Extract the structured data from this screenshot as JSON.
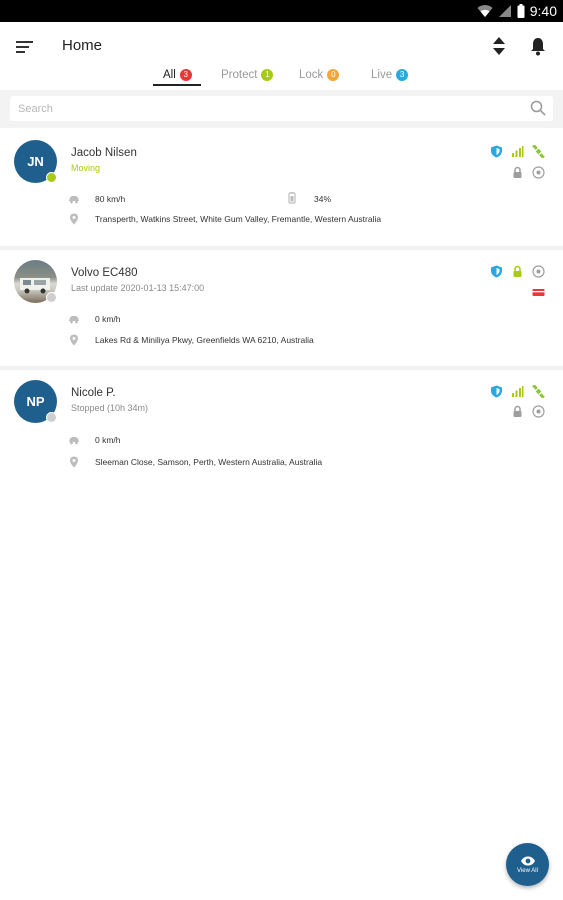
{
  "status_bar": {
    "time": "9:40"
  },
  "header": {
    "title": "Home"
  },
  "tabs": [
    {
      "label": "All",
      "count": "3",
      "badge_color": "#e53935"
    },
    {
      "label": "Protect",
      "count": "1",
      "badge_color": "#a8c919"
    },
    {
      "label": "Lock",
      "count": "0",
      "badge_color": "#f2a53a"
    },
    {
      "label": "Live",
      "count": "3",
      "badge_color": "#29a9e0"
    }
  ],
  "search": {
    "placeholder": "Search"
  },
  "assets": [
    {
      "initials": "JN",
      "name": "Jacob Nilsen",
      "status": "Moving",
      "status_dot_color": "#a8c919",
      "speed": "80 km/h",
      "battery": "34%",
      "address": "Transperth, Watkins Street, White Gum Valley, Fremantle, Western Australia"
    },
    {
      "initials": "",
      "name": "Volvo EC480",
      "status": "Last update 2020-01-13 15:47:00",
      "status_dot_color": "#cfcfcf",
      "speed": "0 km/h",
      "address": "Lakes Rd & Miniliya Pkwy, Greenfields WA 6210, Australia"
    },
    {
      "initials": "NP",
      "name": "Nicole P.",
      "status": "Stopped (10h 34m)",
      "status_dot_color": "#cfcfcf",
      "speed": "0 km/h",
      "address": "Sleeman Close, Samson, Perth, Western Australia, Australia"
    }
  ],
  "fab": {
    "label": "View All"
  },
  "colors": {
    "accent_blue": "#1f5f8e",
    "lime": "#a8c919",
    "cyan": "#29a9e0",
    "red": "#e53935"
  }
}
